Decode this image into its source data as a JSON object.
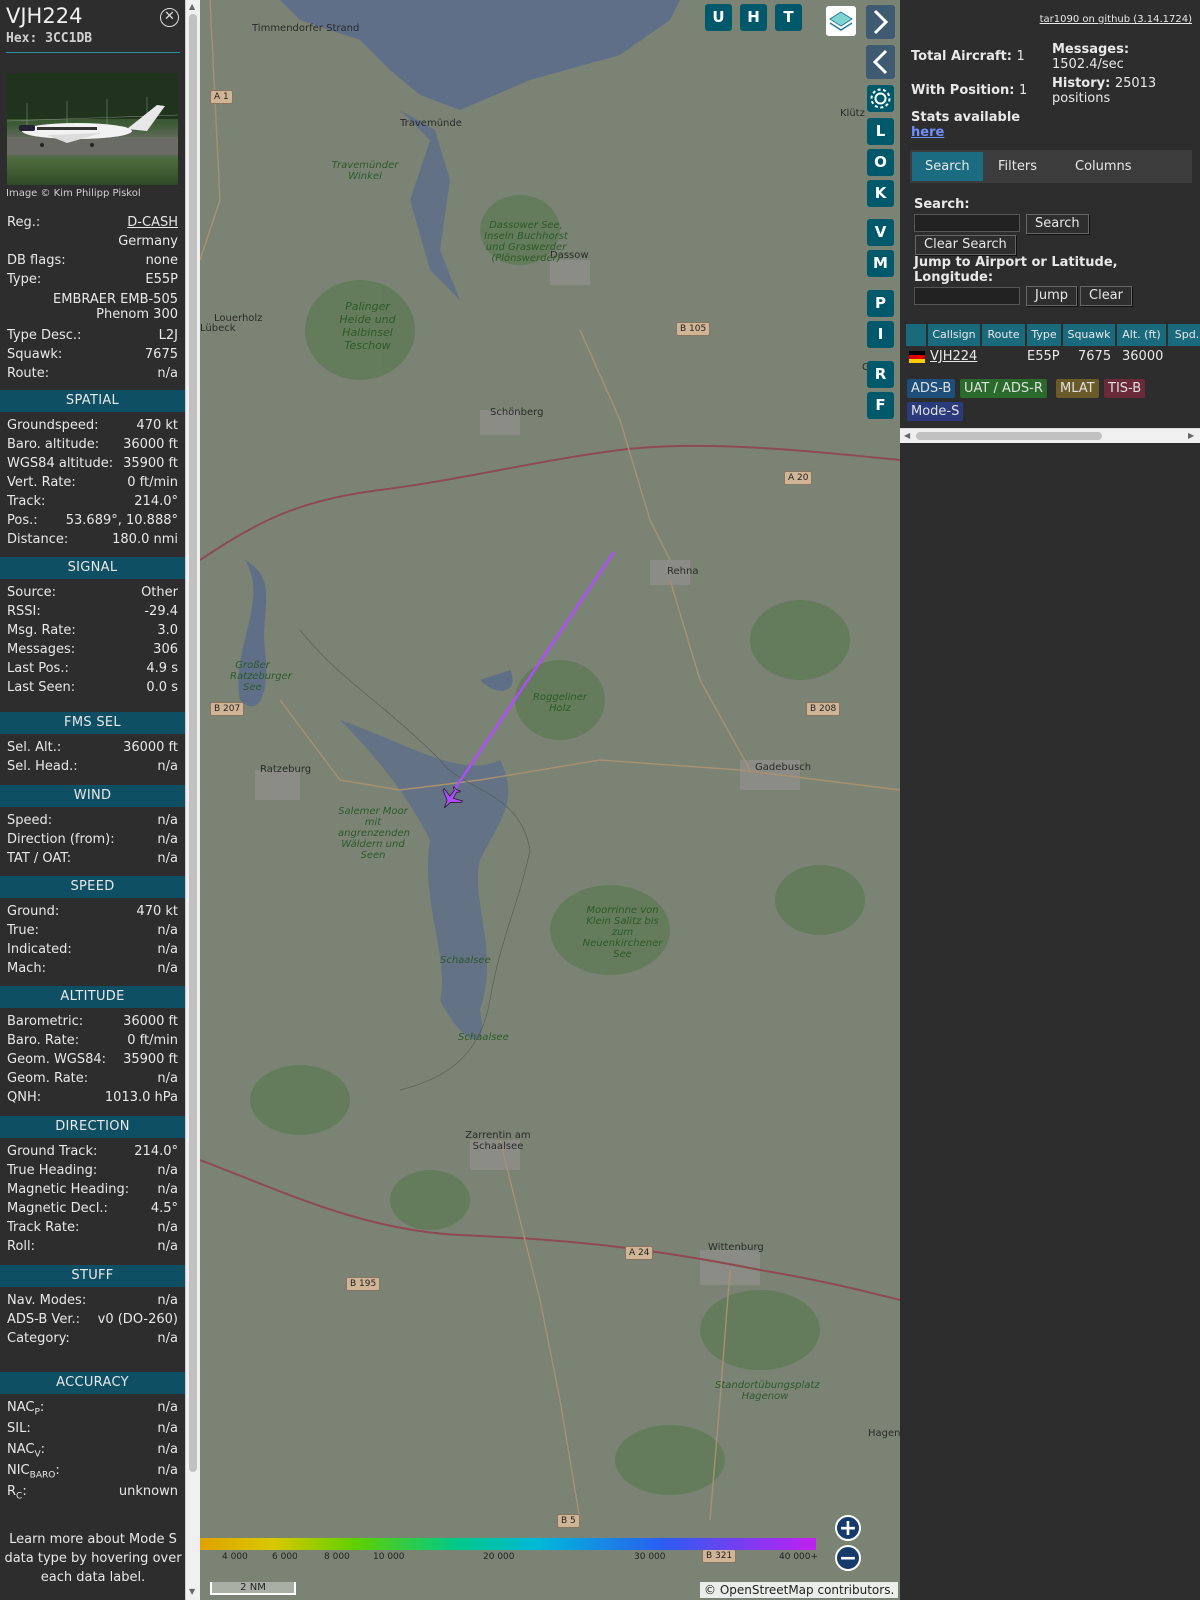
{
  "aircraft": {
    "callsign": "VJH224",
    "hex_label": "Hex: 3CC1DB",
    "photo_credit": "Image © Kim Philipp Piskol"
  },
  "info": {
    "reg_label": "Reg.:",
    "reg_value": "D-CASH",
    "country": "Germany",
    "dbflags_label": "DB flags:",
    "dbflags_value": "none",
    "type_label": "Type:",
    "type_value": "E55P",
    "model_line1": "EMBRAER EMB-505",
    "model_line2": "Phenom 300",
    "typedesc_label": "Type Desc.:",
    "typedesc_value": "L2J",
    "squawk_label": "Squawk:",
    "squawk_value": "7675",
    "route_label": "Route:",
    "route_value": "n/a"
  },
  "sections": {
    "spatial": {
      "title": "SPATIAL",
      "rows": [
        {
          "label": "Groundspeed:",
          "value": "470 kt"
        },
        {
          "label": "Baro. altitude:",
          "value": "36000 ft"
        },
        {
          "label": "WGS84 altitude:",
          "value": "35900 ft"
        },
        {
          "label": "Vert. Rate:",
          "value": "0 ft/min"
        },
        {
          "label": "Track:",
          "value": "214.0°"
        },
        {
          "label": "Pos.:",
          "value": "53.689°, 10.888°"
        },
        {
          "label": "Distance:",
          "value": "180.0 nmi"
        }
      ]
    },
    "signal": {
      "title": "SIGNAL",
      "rows": [
        {
          "label": "Source:",
          "value": "Other"
        },
        {
          "label": "RSSI:",
          "value": "-29.4"
        },
        {
          "label": "Msg. Rate:",
          "value": "3.0"
        },
        {
          "label": "Messages:",
          "value": "306"
        },
        {
          "label": "Last Pos.:",
          "value": "4.9 s"
        },
        {
          "label": "Last Seen:",
          "value": "0.0 s"
        }
      ]
    },
    "fms": {
      "title": "FMS SEL",
      "rows": [
        {
          "label": "Sel. Alt.:",
          "value": "36000 ft"
        },
        {
          "label": "Sel. Head.:",
          "value": "n/a"
        }
      ]
    },
    "wind": {
      "title": "WIND",
      "rows": [
        {
          "label": "Speed:",
          "value": "n/a"
        },
        {
          "label": "Direction (from):",
          "value": "n/a"
        },
        {
          "label": "TAT / OAT:",
          "value": "n/a"
        }
      ]
    },
    "speed": {
      "title": "SPEED",
      "rows": [
        {
          "label": "Ground:",
          "value": "470 kt"
        },
        {
          "label": "True:",
          "value": "n/a"
        },
        {
          "label": "Indicated:",
          "value": "n/a"
        },
        {
          "label": "Mach:",
          "value": "n/a"
        }
      ]
    },
    "altitude": {
      "title": "ALTITUDE",
      "rows": [
        {
          "label": "Barometric:",
          "value": "36000 ft"
        },
        {
          "label": "Baro. Rate:",
          "value": "0 ft/min"
        },
        {
          "label": "Geom. WGS84:",
          "value": "35900 ft"
        },
        {
          "label": "Geom. Rate:",
          "value": "n/a"
        },
        {
          "label": "QNH:",
          "value": "1013.0 hPa"
        }
      ]
    },
    "direction": {
      "title": "DIRECTION",
      "rows": [
        {
          "label": "Ground Track:",
          "value": "214.0°"
        },
        {
          "label": "True Heading:",
          "value": "n/a"
        },
        {
          "label": "Magnetic Heading:",
          "value": "n/a"
        },
        {
          "label": "Magnetic Decl.:",
          "value": "4.5°"
        },
        {
          "label": "Track Rate:",
          "value": "n/a"
        },
        {
          "label": "Roll:",
          "value": "n/a"
        }
      ]
    },
    "stuff": {
      "title": "STUFF",
      "rows": [
        {
          "label": "Nav. Modes:",
          "value": "n/a"
        },
        {
          "label": "ADS-B Ver.:",
          "value": "v0 (DO-260)"
        },
        {
          "label": "Category:",
          "value": "n/a"
        }
      ]
    },
    "accuracy": {
      "title": "ACCURACY",
      "rows": [
        {
          "label": "NACP:",
          "label_main": "NAC",
          "label_sub": "P",
          "value": "n/a"
        },
        {
          "label": "SIL:",
          "value": "n/a"
        },
        {
          "label": "NACV:",
          "label_main": "NAC",
          "label_sub": "V",
          "value": "n/a"
        },
        {
          "label": "NICBARO:",
          "label_main": "NIC",
          "label_sub": "BARO",
          "value": "n/a"
        },
        {
          "label": "RC:",
          "label_main": "R",
          "label_sub": "C",
          "value": "unknown"
        }
      ]
    }
  },
  "learn_more": "Learn more about Mode S data type by hovering over each data label.",
  "map": {
    "toolbar": [
      "U",
      "H",
      "T"
    ],
    "side_buttons": [
      "L",
      "O",
      "K",
      "V",
      "M",
      "P",
      "I",
      "R",
      "F"
    ],
    "labels": [
      "Timmendorfer Strand",
      "Travemünde",
      "Dassow",
      "Schönberg",
      "Rehna",
      "Ratzeburg",
      "Gadebusch",
      "Zarrentin am Schaalsee",
      "Wittenburg",
      "Hagen",
      "Klütz",
      "Gre",
      "Louerholz",
      "Lübeck"
    ],
    "green_labels": [
      "Travemünder Winkel",
      "Dassower See, Inseln Buchhorst und Graswerder (Plönswerder)",
      "Palinger Heide und Halbinsel Teschow",
      "Roggeliner Holz",
      "Großer Ratzeburger See",
      "Salemer Moor mit angrenzenden Wäldern und Seen",
      "Moorrinne von Klein Salitz bis zum Neuenkirchener See",
      "Schaalsee",
      "Schaalsee",
      "Standortübungsplatz Hagenow"
    ],
    "roads": [
      "A 1",
      "B 105",
      "A 20",
      "B 207",
      "B 208",
      "A 24",
      "B 195",
      "B 5",
      "B 321"
    ],
    "altitude_legend": [
      "4 000",
      "6 000",
      "8 000",
      "10 000",
      "20 000",
      "30 000",
      "40 000+"
    ],
    "scale": "2 NM",
    "attribution": "© OpenStreetMap contributors.",
    "zoom_in": "+",
    "zoom_out": "−"
  },
  "panel": {
    "version": "tar1090 on github (3.14.1724)",
    "total_label": "Total Aircraft:",
    "total_value": "1",
    "pos_label": "With Position:",
    "pos_value": "1",
    "stats_label": "Stats available",
    "stats_link": "here",
    "messages_label": "Messages:",
    "messages_value": "1502.4/sec",
    "history_label": "History:",
    "history_value": "25013 positions",
    "tabs": [
      "Search",
      "Filters",
      "Columns"
    ],
    "search_label": "Search:",
    "search_button": "Search",
    "clear_search_button": "Clear Search",
    "jump_label": "Jump to Airport or Latitude, Longitude:",
    "jump_button": "Jump",
    "clear_button": "Clear",
    "table": {
      "headers": [
        "Callsign",
        "Route",
        "Type",
        "Squawk",
        "Alt. (ft)",
        "Spd."
      ],
      "row": {
        "callsign": "VJH224",
        "route": "",
        "type": "E55P",
        "squawk": "7675",
        "alt": "36000"
      }
    },
    "badges": [
      "ADS-B",
      "UAT / ADS-R",
      "MLAT",
      "TIS-B",
      "Mode-S"
    ]
  },
  "colors": {
    "accent": "#0f4f63",
    "track": "#b04cff",
    "badge_adsb": "#1d4e7a",
    "badge_uat": "#2a6a2a",
    "badge_mlat": "#6a5a2a",
    "badge_tisb": "#6a2a3a",
    "badge_modes": "#2a3a7a"
  }
}
